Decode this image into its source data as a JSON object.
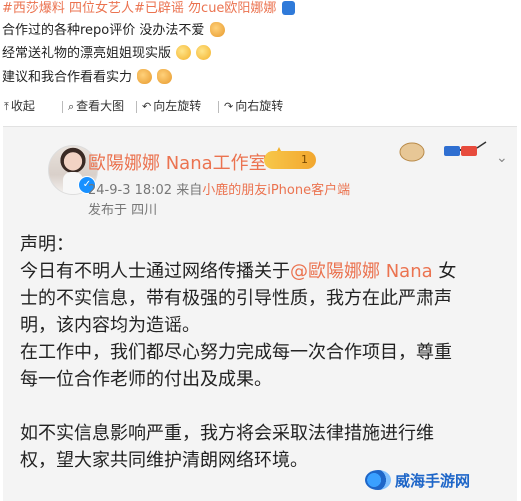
{
  "feed_lines": {
    "line1_tags": "#西莎爆料 四位女艺人#已辟谣 勿cue欧阳娜娜",
    "line2": "合作过的各种repo评价 没办法不爱",
    "line3": "经常送礼物的漂亮姐姐现实版",
    "line4": "建议和我合作看看实力"
  },
  "toolbar": {
    "collapse": "收起",
    "view_large": "查看大图",
    "rotate_left": "向左旋转",
    "rotate_right": "向右旋转"
  },
  "post": {
    "author": "歐陽娜娜 Nana工作室",
    "vip_level": "1",
    "timestamp": "24-9-3 18:02",
    "source_prefix": "来自",
    "source_client": "小鹿的朋友iPhone客户端",
    "location": "发布于 四川",
    "body": {
      "l1": "声明：",
      "l2_before": "今日有不明人士通过网络传播关于",
      "l2_mention": "@歐陽娜娜 Nana",
      "l2_after": "女",
      "l3": "士的不实信息，带有极强的引导性质，我方在此严肃声",
      "l4": "明，该内容均为造谣。",
      "l5": "在工作中，我们都尽心努力完成每一次合作项目，尊重",
      "l6": "每一位合作老师的付出及成果。",
      "l7": "如不实信息影响严重，我方将会采取法律措施进行维",
      "l8": "权，望大家共同维护清朗网络环境。"
    }
  },
  "watermark": "威海手游网",
  "colors": {
    "accent_orange": "#eb7350",
    "verified_blue": "#1890ff",
    "watermark_blue": "#1e66c8"
  },
  "icons": [
    "collapse-icon",
    "view-large-icon",
    "rotate-left-icon",
    "rotate-right-icon",
    "verified-icon",
    "crown-icon",
    "chevron-down-icon"
  ]
}
